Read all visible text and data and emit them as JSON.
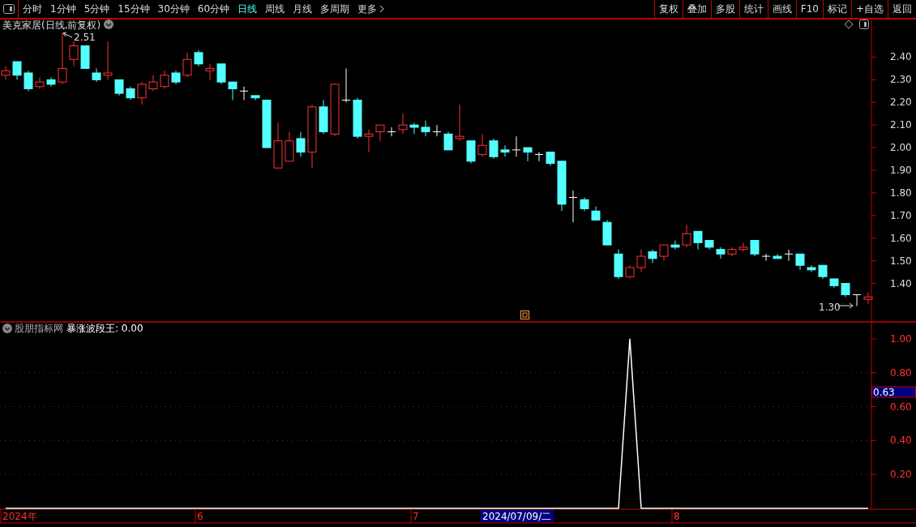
{
  "toolbar": {
    "periods": [
      {
        "label": "分时",
        "selected": false
      },
      {
        "label": "1分钟",
        "selected": false
      },
      {
        "label": "5分钟",
        "selected": false
      },
      {
        "label": "15分钟",
        "selected": false
      },
      {
        "label": "30分钟",
        "selected": false
      },
      {
        "label": "60分钟",
        "selected": false
      },
      {
        "label": "日线",
        "selected": true
      },
      {
        "label": "周线",
        "selected": false
      },
      {
        "label": "月线",
        "selected": false
      },
      {
        "label": "多周期",
        "selected": false
      },
      {
        "label": "更多",
        "selected": false
      }
    ],
    "buttons": [
      "复权",
      "叠加",
      "多股",
      "统计",
      "画线",
      "F10",
      "标记",
      "+自选",
      "返回"
    ]
  },
  "price_chart": {
    "title": "美克家居(日线,前复权)",
    "high_marker": "2.51",
    "low_marker": "1.30",
    "chart_data": {
      "type": "candlestick",
      "ylim": [
        1.23,
        2.57
      ],
      "grid": false,
      "yticks": [
        {
          "value": 2.4,
          "label": "2.40"
        },
        {
          "value": 2.3,
          "label": "2.30"
        },
        {
          "value": 2.2,
          "label": "2.20"
        },
        {
          "value": 2.1,
          "label": "2.10"
        },
        {
          "value": 2.0,
          "label": "2.00"
        },
        {
          "value": 1.9,
          "label": "1.90"
        },
        {
          "value": 1.8,
          "label": "1.80"
        },
        {
          "value": 1.7,
          "label": "1.70"
        },
        {
          "value": 1.6,
          "label": "1.60"
        },
        {
          "value": 1.5,
          "label": "1.50"
        },
        {
          "value": 1.4,
          "label": "1.40"
        }
      ],
      "ohlc": [
        [
          2.32,
          2.36,
          2.3,
          2.34
        ],
        [
          2.38,
          2.38,
          2.3,
          2.32
        ],
        [
          2.33,
          2.34,
          2.25,
          2.26
        ],
        [
          2.27,
          2.31,
          2.26,
          2.29
        ],
        [
          2.3,
          2.31,
          2.27,
          2.28
        ],
        [
          2.29,
          2.51,
          2.28,
          2.35
        ],
        [
          2.39,
          2.47,
          2.36,
          2.45
        ],
        [
          2.45,
          2.45,
          2.35,
          2.35
        ],
        [
          2.33,
          2.35,
          2.29,
          2.3
        ],
        [
          2.32,
          2.47,
          2.3,
          2.33
        ],
        [
          2.3,
          2.3,
          2.23,
          2.24
        ],
        [
          2.26,
          2.27,
          2.21,
          2.22
        ],
        [
          2.22,
          2.29,
          2.19,
          2.28
        ],
        [
          2.26,
          2.32,
          2.25,
          2.29
        ],
        [
          2.27,
          2.34,
          2.26,
          2.32
        ],
        [
          2.33,
          2.34,
          2.28,
          2.29
        ],
        [
          2.32,
          2.42,
          2.31,
          2.39
        ],
        [
          2.42,
          2.43,
          2.36,
          2.37
        ],
        [
          2.34,
          2.37,
          2.3,
          2.35
        ],
        [
          2.37,
          2.37,
          2.28,
          2.29
        ],
        [
          2.29,
          2.29,
          2.21,
          2.26
        ],
        [
          2.25,
          2.27,
          2.21,
          2.25
        ],
        [
          2.23,
          2.23,
          2.21,
          2.22
        ],
        [
          2.21,
          2.21,
          2.0,
          2.0
        ],
        [
          1.91,
          2.11,
          1.91,
          2.03
        ],
        [
          1.94,
          2.07,
          1.94,
          2.03
        ],
        [
          2.04,
          2.07,
          1.96,
          1.98
        ],
        [
          1.98,
          2.19,
          1.91,
          2.18
        ],
        [
          2.18,
          2.21,
          2.06,
          2.07
        ],
        [
          2.06,
          2.28,
          2.05,
          2.28
        ],
        [
          2.21,
          2.35,
          2.2,
          2.21
        ],
        [
          2.21,
          2.22,
          2.04,
          2.05
        ],
        [
          2.05,
          2.08,
          1.98,
          2.06
        ],
        [
          2.07,
          2.1,
          2.03,
          2.1
        ],
        [
          2.07,
          2.09,
          2.05,
          2.07
        ],
        [
          2.08,
          2.15,
          2.06,
          2.1
        ],
        [
          2.1,
          2.11,
          2.06,
          2.09
        ],
        [
          2.09,
          2.12,
          2.05,
          2.07
        ],
        [
          2.07,
          2.1,
          2.05,
          2.07
        ],
        [
          2.06,
          2.07,
          1.99,
          1.99
        ],
        [
          2.04,
          2.19,
          2.03,
          2.05
        ],
        [
          2.03,
          2.03,
          1.93,
          1.94
        ],
        [
          1.97,
          2.06,
          1.96,
          2.01
        ],
        [
          2.03,
          2.04,
          1.95,
          1.96
        ],
        [
          1.99,
          2.01,
          1.96,
          1.98
        ],
        [
          1.99,
          2.05,
          1.96,
          1.99
        ],
        [
          2.0,
          2.0,
          1.94,
          1.98
        ],
        [
          1.97,
          1.98,
          1.94,
          1.97
        ],
        [
          1.98,
          1.98,
          1.92,
          1.93
        ],
        [
          1.94,
          1.94,
          1.72,
          1.75
        ],
        [
          1.78,
          1.81,
          1.67,
          1.78
        ],
        [
          1.77,
          1.78,
          1.72,
          1.73
        ],
        [
          1.72,
          1.74,
          1.68,
          1.68
        ],
        [
          1.67,
          1.68,
          1.57,
          1.57
        ],
        [
          1.53,
          1.55,
          1.42,
          1.43
        ],
        [
          1.43,
          1.48,
          1.42,
          1.47
        ],
        [
          1.47,
          1.55,
          1.45,
          1.52
        ],
        [
          1.54,
          1.55,
          1.49,
          1.51
        ],
        [
          1.52,
          1.57,
          1.5,
          1.57
        ],
        [
          1.57,
          1.59,
          1.55,
          1.56
        ],
        [
          1.57,
          1.66,
          1.56,
          1.62
        ],
        [
          1.63,
          1.63,
          1.55,
          1.58
        ],
        [
          1.59,
          1.59,
          1.55,
          1.56
        ],
        [
          1.55,
          1.56,
          1.51,
          1.53
        ],
        [
          1.53,
          1.56,
          1.52,
          1.55
        ],
        [
          1.55,
          1.58,
          1.54,
          1.56
        ],
        [
          1.59,
          1.59,
          1.52,
          1.53
        ],
        [
          1.52,
          1.53,
          1.5,
          1.52
        ],
        [
          1.52,
          1.53,
          1.51,
          1.51
        ],
        [
          1.53,
          1.55,
          1.5,
          1.53
        ],
        [
          1.53,
          1.53,
          1.46,
          1.48
        ],
        [
          1.47,
          1.48,
          1.45,
          1.46
        ],
        [
          1.48,
          1.48,
          1.42,
          1.43
        ],
        [
          1.42,
          1.42,
          1.38,
          1.39
        ],
        [
          1.4,
          1.4,
          1.34,
          1.35
        ],
        [
          1.35,
          1.35,
          1.3,
          1.35
        ],
        [
          1.33,
          1.36,
          1.31,
          1.34
        ]
      ]
    }
  },
  "indicator": {
    "source": "股朋指标网",
    "name_value": "暴涨波段王: 0.00",
    "cursor_value": "0.63",
    "chart_data": {
      "type": "line",
      "ylim": [
        0,
        1.1
      ],
      "grid": true,
      "yticks": [
        {
          "value": 0.2,
          "label": "0.20"
        },
        {
          "value": 0.4,
          "label": "0.40"
        },
        {
          "value": 0.6,
          "label": "0.60"
        },
        {
          "value": 0.8,
          "label": "0.80"
        },
        {
          "value": 1,
          "label": "1.00"
        }
      ],
      "values": [
        0,
        0,
        0,
        0,
        0,
        0,
        0,
        0,
        0,
        0,
        0,
        0,
        0,
        0,
        0,
        0,
        0,
        0,
        0,
        0,
        0,
        0,
        0,
        0,
        0,
        0,
        0,
        0,
        0,
        0,
        0,
        0,
        0,
        0,
        0,
        0,
        0,
        0,
        0,
        0,
        0,
        0,
        0,
        0,
        0,
        0,
        0,
        0,
        0,
        0,
        0,
        0,
        0,
        0,
        0,
        1,
        0,
        0,
        0,
        0,
        0,
        0,
        0,
        0,
        0,
        0,
        0,
        0,
        0,
        0,
        0,
        0,
        0,
        0,
        0,
        0,
        0
      ]
    }
  },
  "date_axis": {
    "labels": [
      "2024年",
      "6",
      "7",
      "8"
    ],
    "cursor_date": "2024/07/09/二"
  }
}
